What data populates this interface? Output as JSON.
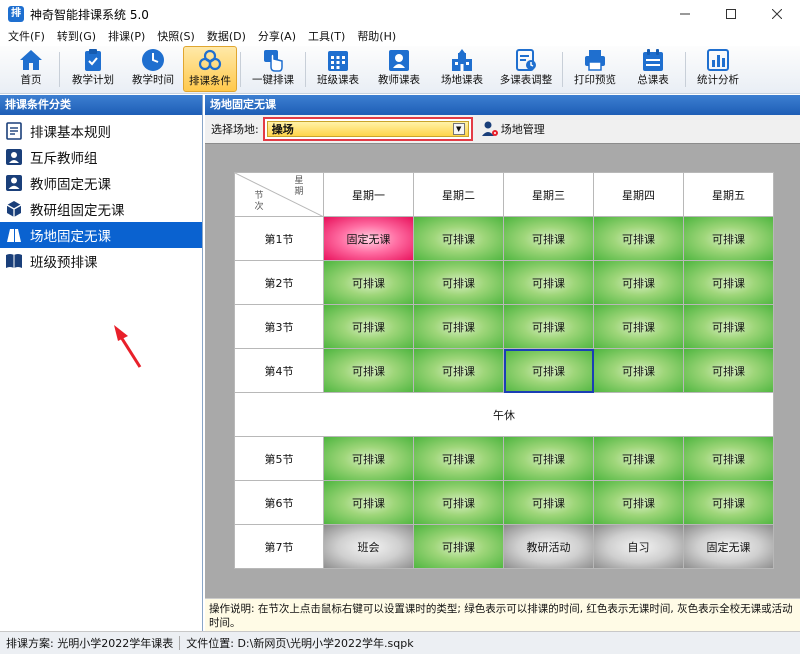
{
  "window": {
    "title": "神奇智能排课系统 5.0",
    "controls": [
      "minimize",
      "maximize",
      "close"
    ]
  },
  "menu": [
    "文件(F)",
    "转到(G)",
    "排课(P)",
    "快照(S)",
    "数据(D)",
    "分享(A)",
    "工具(T)",
    "帮助(H)"
  ],
  "toolbar": [
    {
      "label": "首页",
      "icon": "home-icon"
    },
    {
      "label": "教学计划",
      "icon": "clipboard-check-icon"
    },
    {
      "label": "教学时间",
      "icon": "clock-icon"
    },
    {
      "label": "排课条件",
      "icon": "conditions-icon",
      "active": true
    },
    {
      "label": "一键排课",
      "icon": "tap-icon"
    },
    {
      "label": "班级课表",
      "icon": "calendar-grid-icon"
    },
    {
      "label": "教师课表",
      "icon": "teacher-schedule-icon"
    },
    {
      "label": "场地课表",
      "icon": "venue-schedule-icon"
    },
    {
      "label": "多课表调整",
      "icon": "multi-schedule-icon"
    },
    {
      "label": "打印预览",
      "icon": "printer-icon"
    },
    {
      "label": "总课表",
      "icon": "master-schedule-icon"
    },
    {
      "label": "统计分析",
      "icon": "bar-chart-icon"
    }
  ],
  "left_panel": {
    "title": "排课条件分类",
    "items": [
      {
        "label": "排课基本规则",
        "icon": "rules-doc-icon"
      },
      {
        "label": "互斥教师组",
        "icon": "exclusive-teacher-icon"
      },
      {
        "label": "教师固定无课",
        "icon": "teacher-icon"
      },
      {
        "label": "教研组固定无课",
        "icon": "cube-icon"
      },
      {
        "label": "场地固定无课",
        "icon": "venue-icon",
        "selected": true
      },
      {
        "label": "班级预排课",
        "icon": "book-icon"
      }
    ]
  },
  "right_panel": {
    "title": "场地固定无课",
    "select_label": "选择场地:",
    "selected_venue": "操场",
    "venue_mgmt_label": "场地管理",
    "corner_top": "星期",
    "corner_bottom": "节次",
    "days": [
      "星期一",
      "星期二",
      "星期三",
      "星期四",
      "星期五"
    ],
    "lunch": "午休",
    "rows_am": [
      {
        "period": "第1节",
        "cells": [
          {
            "t": "固定无课",
            "s": "fixed"
          },
          {
            "t": "可排课",
            "s": "ok"
          },
          {
            "t": "可排课",
            "s": "ok"
          },
          {
            "t": "可排课",
            "s": "ok"
          },
          {
            "t": "可排课",
            "s": "ok"
          }
        ]
      },
      {
        "period": "第2节",
        "cells": [
          {
            "t": "可排课",
            "s": "ok"
          },
          {
            "t": "可排课",
            "s": "ok"
          },
          {
            "t": "可排课",
            "s": "ok"
          },
          {
            "t": "可排课",
            "s": "ok"
          },
          {
            "t": "可排课",
            "s": "ok"
          }
        ]
      },
      {
        "period": "第3节",
        "cells": [
          {
            "t": "可排课",
            "s": "ok"
          },
          {
            "t": "可排课",
            "s": "ok"
          },
          {
            "t": "可排课",
            "s": "ok"
          },
          {
            "t": "可排课",
            "s": "ok"
          },
          {
            "t": "可排课",
            "s": "ok"
          }
        ]
      },
      {
        "period": "第4节",
        "cells": [
          {
            "t": "可排课",
            "s": "ok"
          },
          {
            "t": "可排课",
            "s": "ok"
          },
          {
            "t": "可排课",
            "s": "ok",
            "focus": true
          },
          {
            "t": "可排课",
            "s": "ok"
          },
          {
            "t": "可排课",
            "s": "ok"
          }
        ]
      }
    ],
    "rows_pm": [
      {
        "period": "第5节",
        "cells": [
          {
            "t": "可排课",
            "s": "ok"
          },
          {
            "t": "可排课",
            "s": "ok"
          },
          {
            "t": "可排课",
            "s": "ok"
          },
          {
            "t": "可排课",
            "s": "ok"
          },
          {
            "t": "可排课",
            "s": "ok"
          }
        ]
      },
      {
        "period": "第6节",
        "cells": [
          {
            "t": "可排课",
            "s": "ok"
          },
          {
            "t": "可排课",
            "s": "ok"
          },
          {
            "t": "可排课",
            "s": "ok"
          },
          {
            "t": "可排课",
            "s": "ok"
          },
          {
            "t": "可排课",
            "s": "ok"
          }
        ]
      },
      {
        "period": "第7节",
        "cells": [
          {
            "t": "班会",
            "s": "gray"
          },
          {
            "t": "可排课",
            "s": "ok"
          },
          {
            "t": "教研活动",
            "s": "gray"
          },
          {
            "t": "自习",
            "s": "gray"
          },
          {
            "t": "固定无课",
            "s": "gray"
          }
        ]
      }
    ],
    "help_text": "操作说明: 在节次上点击鼠标右键可以设置课时的类型; 绿色表示可以排课的时间, 红色表示无课时间, 灰色表示全校无课或活动时间。"
  },
  "status_bar": {
    "plan_label": "排课方案:",
    "plan_value": "光明小学2022学年课表",
    "file_label": "文件位置:",
    "file_value": "D:\\新网页\\光明小学2022学年.sqpk"
  }
}
